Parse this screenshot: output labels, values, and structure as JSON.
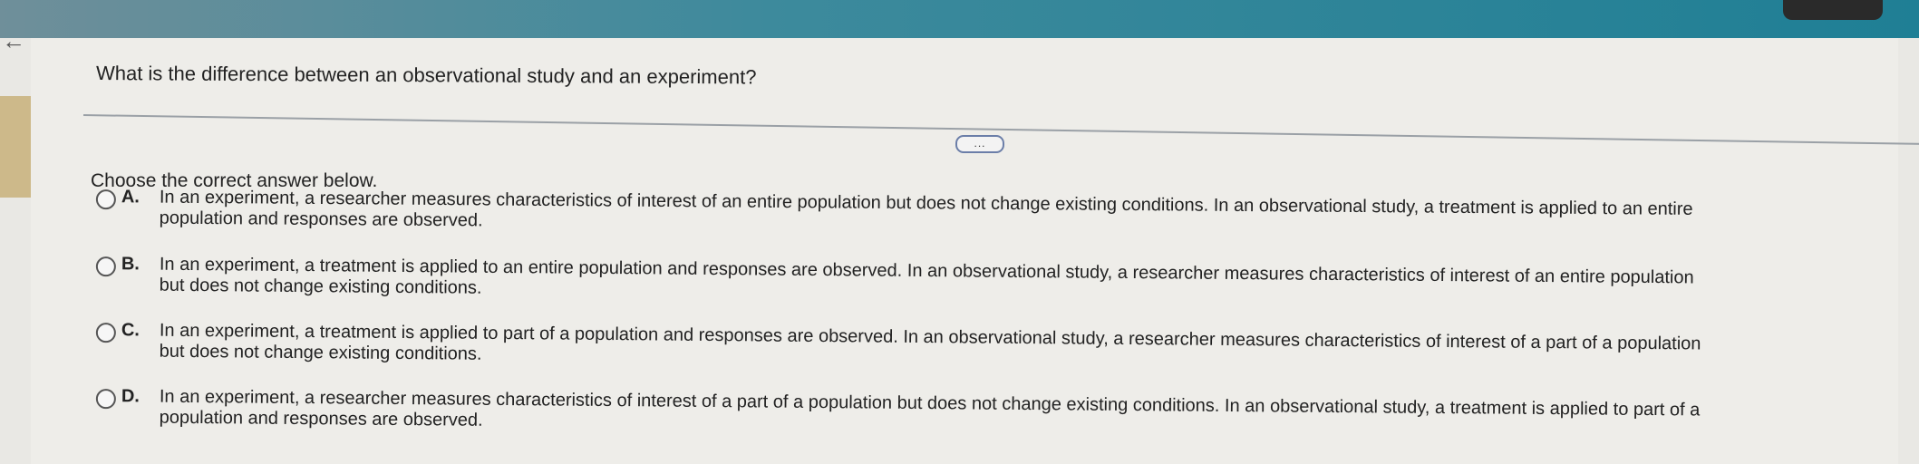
{
  "question": "What is the difference between an observational study and an experiment?",
  "more_button": "...",
  "instruction": "Choose the correct answer below.",
  "options": [
    {
      "letter": "A.",
      "line1": "In an experiment, a researcher measures characteristics of interest of an entire population but does not change existing conditions. In an observational study, a treatment is applied to an entire",
      "line2": "population and responses are observed."
    },
    {
      "letter": "B.",
      "line1": "In an experiment, a treatment is applied to an entire population and responses are observed. In an observational study, a researcher measures characteristics of interest of an entire population",
      "line2": "but does not change existing conditions."
    },
    {
      "letter": "C.",
      "line1": "In an experiment, a treatment is applied to part of a population and responses are observed. In an observational study, a researcher measures characteristics of interest of a part of a population",
      "line2": "but does not change existing conditions."
    },
    {
      "letter": "D.",
      "line1": "In an experiment, a researcher measures characteristics of interest of a part of a population but does not change existing conditions. In an observational study, a treatment is applied to part of a",
      "line2": "population and responses are observed."
    }
  ],
  "colors": {
    "header": "#1f7f95",
    "accent_tab": "#cdb98a",
    "more_button_border": "#6b7ea8"
  },
  "icons": {
    "back": "left-arrow-icon"
  }
}
